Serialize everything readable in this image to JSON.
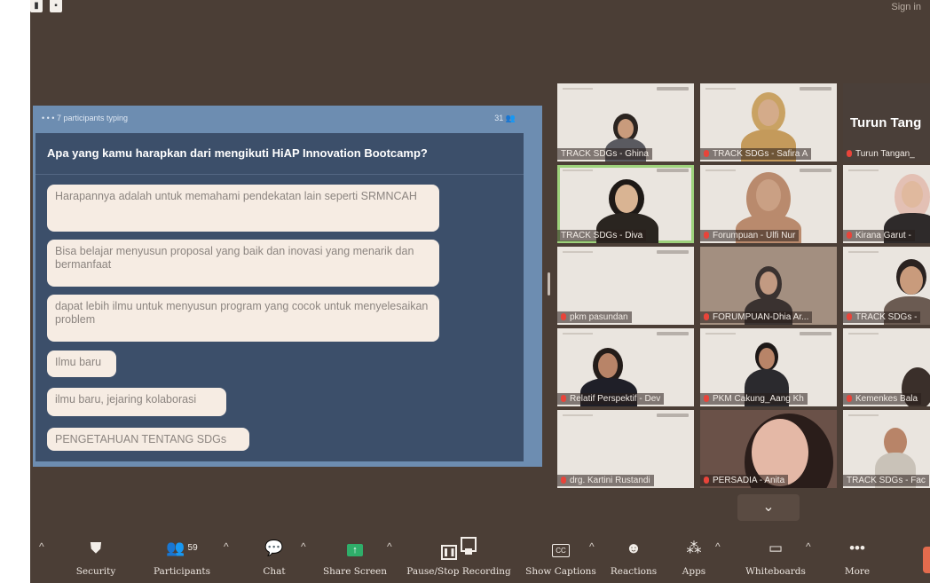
{
  "window": {
    "sign_in": "Sign in"
  },
  "share": {
    "typing_text": "7 participants typing",
    "response_count": "31",
    "question": "Apa yang kamu harapkan dari mengikuti HiAP Innovation Bootcamp?",
    "answers": [
      "Harapannya adalah untuk memahami pendekatan lain seperti SRMNCAH",
      "Bisa belajar menyusun proposal yang baik dan inovasi yang menarik dan bermanfaat",
      "dapat lebih ilmu untuk menyusun program yang cocok untuk menyelesaikan problem",
      "Ilmu baru",
      "ilmu baru, jejaring kolaborasi",
      "PENGETAHUAN TENTANG SDGs"
    ]
  },
  "participants": [
    {
      "name": "TRACK SDGs - Ghina",
      "muted": false
    },
    {
      "name": "TRACK SDGs - Safira A",
      "muted": true
    },
    {
      "name": "Turun Tangan_",
      "muted": true,
      "slide_title": "Turun Tang"
    },
    {
      "name": "TRACK SDGs - Diva",
      "muted": false
    },
    {
      "name": "Forumpuan - Ulfi Nur",
      "muted": true
    },
    {
      "name": "Kirana Garut -",
      "muted": true
    },
    {
      "name": "pkm pasundan",
      "muted": true
    },
    {
      "name": "FORUMPUAN-Dhia Ar...",
      "muted": true
    },
    {
      "name": "TRACK SDGs -",
      "muted": true
    },
    {
      "name": "Relatif Perspektif - Dev",
      "muted": true
    },
    {
      "name": "PKM Cakung_Aang Kh",
      "muted": true
    },
    {
      "name": "Kemenkes Bala",
      "muted": true
    },
    {
      "name": "drg. Kartini Rustandi",
      "muted": true
    },
    {
      "name": "PERSADIA - Anita",
      "muted": true
    },
    {
      "name": "TRACK SDGs - Fac",
      "muted": false
    }
  ],
  "toolbar": {
    "security": "Security",
    "participants": "Participants",
    "participants_count": "59",
    "chat": "Chat",
    "share_screen": "Share Screen",
    "recording": "Pause/Stop Recording",
    "captions": "Show Captions",
    "captions_icon_text": "CC",
    "reactions": "Reactions",
    "apps": "Apps",
    "whiteboards": "Whiteboards",
    "more": "More"
  },
  "colors": {
    "background": "#4b3e36",
    "share_bg": "#6d8db1",
    "panel": "#3c4f6a",
    "active_speaker": "#9ed27c",
    "mic_muted": "#e8443a"
  }
}
